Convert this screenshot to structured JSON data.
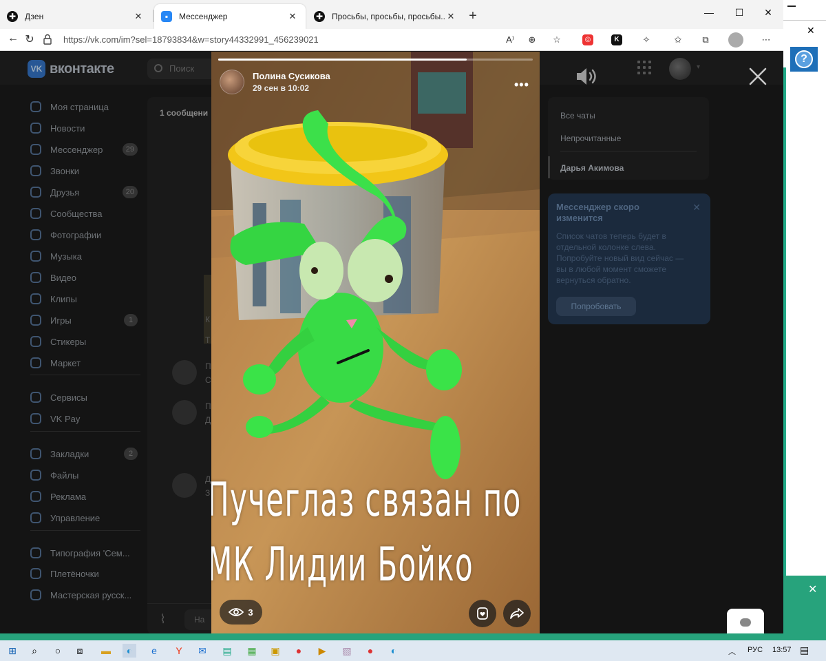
{
  "browser": {
    "tabs": [
      {
        "title": "Дзен",
        "active": false
      },
      {
        "title": "Мессенджер",
        "active": true
      },
      {
        "title": "Просьбы, просьбы, просьбы...",
        "active": false
      }
    ],
    "url": "https://vk.com/im?sel=18793834&w=story44332991_456239021"
  },
  "vk": {
    "logo_text": "вконтакте",
    "search_placeholder": "Поиск",
    "sidebar": [
      {
        "label": "Моя страница",
        "icon": "user-icon"
      },
      {
        "label": "Новости",
        "icon": "news-icon"
      },
      {
        "label": "Мессенджер",
        "icon": "message-icon",
        "badge": "29"
      },
      {
        "label": "Звонки",
        "icon": "phone-icon"
      },
      {
        "label": "Друзья",
        "icon": "friends-icon",
        "badge": "20"
      },
      {
        "label": "Сообщества",
        "icon": "groups-icon"
      },
      {
        "label": "Фотографии",
        "icon": "photo-icon"
      },
      {
        "label": "Музыка",
        "icon": "music-icon"
      },
      {
        "label": "Видео",
        "icon": "video-icon"
      },
      {
        "label": "Клипы",
        "icon": "clips-icon"
      },
      {
        "label": "Игры",
        "icon": "games-icon",
        "badge": "1"
      },
      {
        "label": "Стикеры",
        "icon": "stickers-icon"
      },
      {
        "label": "Маркет",
        "icon": "market-icon"
      },
      {
        "label": "Сервисы",
        "icon": "services-icon"
      },
      {
        "label": "VK Pay",
        "icon": "vkpay-icon"
      },
      {
        "label": "Закладки",
        "icon": "bookmark-icon",
        "badge": "2"
      },
      {
        "label": "Файлы",
        "icon": "files-icon"
      },
      {
        "label": "Реклама",
        "icon": "ads-icon"
      },
      {
        "label": "Управление",
        "icon": "manage-icon"
      },
      {
        "label": "Типография 'Сем...",
        "icon": "group-icon"
      },
      {
        "label": "Плетёночки",
        "icon": "group-icon"
      },
      {
        "label": "Мастерская русск...",
        "icon": "group-icon"
      }
    ],
    "chat_header": "1 сообщени",
    "chat_fragments": [
      "К",
      "Т",
      "П",
      "С",
      "П",
      "Д",
      "Д",
      "З"
    ],
    "composer_placeholder": "На",
    "right_panel": {
      "items": [
        "Все чаты",
        "Непрочитанные",
        "Дарья Акимова"
      ]
    },
    "notice": {
      "title": "Мессенджер скоро изменится",
      "body": "Список чатов теперь будет в отдельной колонке слева. Попробуйте новый вид сейчас — вы в любой момент сможете вернуться обратно.",
      "button": "Попробовать"
    }
  },
  "story": {
    "author_name": "Полина Сусикова",
    "date": "29 сен в 10:02",
    "caption_line1": "Пучеглаз связан по",
    "caption_line2": "МК Лидии Бойко",
    "views": "3",
    "progress": 0.79
  },
  "taskbar": {
    "lang": "РУС",
    "time": "13:57"
  }
}
